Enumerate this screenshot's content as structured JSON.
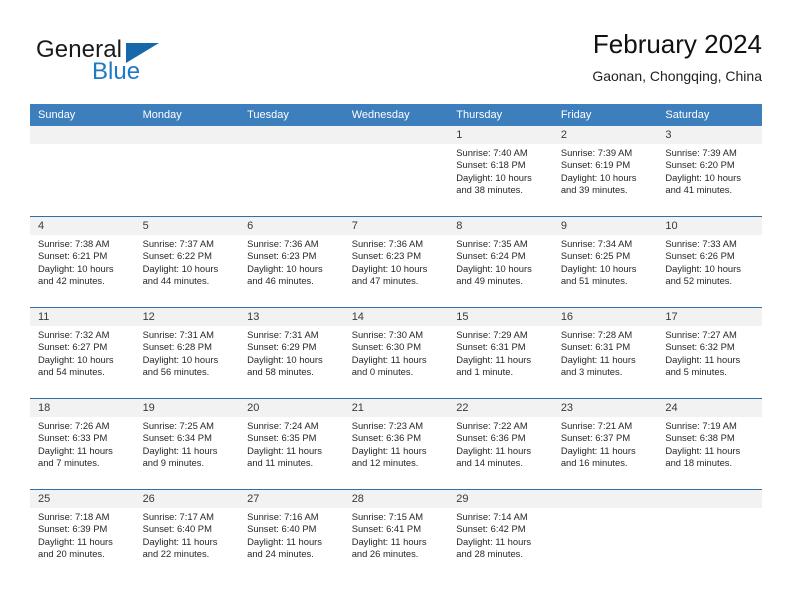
{
  "logo": {
    "word_top": "General",
    "word_bottom": "Blue",
    "triangle_color": "#1767ab",
    "blue_color": "#1f7ac4"
  },
  "header": {
    "title": "February 2024",
    "subtitle": "Gaonan, Chongqing, China"
  },
  "theme": {
    "header_bg": "#3d7ebd",
    "daynum_bg": "#f2f2f2",
    "row_divider": "#2f6fae"
  },
  "weekdays": [
    "Sunday",
    "Monday",
    "Tuesday",
    "Wednesday",
    "Thursday",
    "Friday",
    "Saturday"
  ],
  "weeks": [
    [
      {
        "day": "",
        "sunrise": "",
        "sunset": "",
        "daylight_line1": "",
        "daylight_line2": ""
      },
      {
        "day": "",
        "sunrise": "",
        "sunset": "",
        "daylight_line1": "",
        "daylight_line2": ""
      },
      {
        "day": "",
        "sunrise": "",
        "sunset": "",
        "daylight_line1": "",
        "daylight_line2": ""
      },
      {
        "day": "",
        "sunrise": "",
        "sunset": "",
        "daylight_line1": "",
        "daylight_line2": ""
      },
      {
        "day": "1",
        "sunrise": "Sunrise: 7:40 AM",
        "sunset": "Sunset: 6:18 PM",
        "daylight_line1": "Daylight: 10 hours",
        "daylight_line2": "and 38 minutes."
      },
      {
        "day": "2",
        "sunrise": "Sunrise: 7:39 AM",
        "sunset": "Sunset: 6:19 PM",
        "daylight_line1": "Daylight: 10 hours",
        "daylight_line2": "and 39 minutes."
      },
      {
        "day": "3",
        "sunrise": "Sunrise: 7:39 AM",
        "sunset": "Sunset: 6:20 PM",
        "daylight_line1": "Daylight: 10 hours",
        "daylight_line2": "and 41 minutes."
      }
    ],
    [
      {
        "day": "4",
        "sunrise": "Sunrise: 7:38 AM",
        "sunset": "Sunset: 6:21 PM",
        "daylight_line1": "Daylight: 10 hours",
        "daylight_line2": "and 42 minutes."
      },
      {
        "day": "5",
        "sunrise": "Sunrise: 7:37 AM",
        "sunset": "Sunset: 6:22 PM",
        "daylight_line1": "Daylight: 10 hours",
        "daylight_line2": "and 44 minutes."
      },
      {
        "day": "6",
        "sunrise": "Sunrise: 7:36 AM",
        "sunset": "Sunset: 6:23 PM",
        "daylight_line1": "Daylight: 10 hours",
        "daylight_line2": "and 46 minutes."
      },
      {
        "day": "7",
        "sunrise": "Sunrise: 7:36 AM",
        "sunset": "Sunset: 6:23 PM",
        "daylight_line1": "Daylight: 10 hours",
        "daylight_line2": "and 47 minutes."
      },
      {
        "day": "8",
        "sunrise": "Sunrise: 7:35 AM",
        "sunset": "Sunset: 6:24 PM",
        "daylight_line1": "Daylight: 10 hours",
        "daylight_line2": "and 49 minutes."
      },
      {
        "day": "9",
        "sunrise": "Sunrise: 7:34 AM",
        "sunset": "Sunset: 6:25 PM",
        "daylight_line1": "Daylight: 10 hours",
        "daylight_line2": "and 51 minutes."
      },
      {
        "day": "10",
        "sunrise": "Sunrise: 7:33 AM",
        "sunset": "Sunset: 6:26 PM",
        "daylight_line1": "Daylight: 10 hours",
        "daylight_line2": "and 52 minutes."
      }
    ],
    [
      {
        "day": "11",
        "sunrise": "Sunrise: 7:32 AM",
        "sunset": "Sunset: 6:27 PM",
        "daylight_line1": "Daylight: 10 hours",
        "daylight_line2": "and 54 minutes."
      },
      {
        "day": "12",
        "sunrise": "Sunrise: 7:31 AM",
        "sunset": "Sunset: 6:28 PM",
        "daylight_line1": "Daylight: 10 hours",
        "daylight_line2": "and 56 minutes."
      },
      {
        "day": "13",
        "sunrise": "Sunrise: 7:31 AM",
        "sunset": "Sunset: 6:29 PM",
        "daylight_line1": "Daylight: 10 hours",
        "daylight_line2": "and 58 minutes."
      },
      {
        "day": "14",
        "sunrise": "Sunrise: 7:30 AM",
        "sunset": "Sunset: 6:30 PM",
        "daylight_line1": "Daylight: 11 hours",
        "daylight_line2": "and 0 minutes."
      },
      {
        "day": "15",
        "sunrise": "Sunrise: 7:29 AM",
        "sunset": "Sunset: 6:31 PM",
        "daylight_line1": "Daylight: 11 hours",
        "daylight_line2": "and 1 minute."
      },
      {
        "day": "16",
        "sunrise": "Sunrise: 7:28 AM",
        "sunset": "Sunset: 6:31 PM",
        "daylight_line1": "Daylight: 11 hours",
        "daylight_line2": "and 3 minutes."
      },
      {
        "day": "17",
        "sunrise": "Sunrise: 7:27 AM",
        "sunset": "Sunset: 6:32 PM",
        "daylight_line1": "Daylight: 11 hours",
        "daylight_line2": "and 5 minutes."
      }
    ],
    [
      {
        "day": "18",
        "sunrise": "Sunrise: 7:26 AM",
        "sunset": "Sunset: 6:33 PM",
        "daylight_line1": "Daylight: 11 hours",
        "daylight_line2": "and 7 minutes."
      },
      {
        "day": "19",
        "sunrise": "Sunrise: 7:25 AM",
        "sunset": "Sunset: 6:34 PM",
        "daylight_line1": "Daylight: 11 hours",
        "daylight_line2": "and 9 minutes."
      },
      {
        "day": "20",
        "sunrise": "Sunrise: 7:24 AM",
        "sunset": "Sunset: 6:35 PM",
        "daylight_line1": "Daylight: 11 hours",
        "daylight_line2": "and 11 minutes."
      },
      {
        "day": "21",
        "sunrise": "Sunrise: 7:23 AM",
        "sunset": "Sunset: 6:36 PM",
        "daylight_line1": "Daylight: 11 hours",
        "daylight_line2": "and 12 minutes."
      },
      {
        "day": "22",
        "sunrise": "Sunrise: 7:22 AM",
        "sunset": "Sunset: 6:36 PM",
        "daylight_line1": "Daylight: 11 hours",
        "daylight_line2": "and 14 minutes."
      },
      {
        "day": "23",
        "sunrise": "Sunrise: 7:21 AM",
        "sunset": "Sunset: 6:37 PM",
        "daylight_line1": "Daylight: 11 hours",
        "daylight_line2": "and 16 minutes."
      },
      {
        "day": "24",
        "sunrise": "Sunrise: 7:19 AM",
        "sunset": "Sunset: 6:38 PM",
        "daylight_line1": "Daylight: 11 hours",
        "daylight_line2": "and 18 minutes."
      }
    ],
    [
      {
        "day": "25",
        "sunrise": "Sunrise: 7:18 AM",
        "sunset": "Sunset: 6:39 PM",
        "daylight_line1": "Daylight: 11 hours",
        "daylight_line2": "and 20 minutes."
      },
      {
        "day": "26",
        "sunrise": "Sunrise: 7:17 AM",
        "sunset": "Sunset: 6:40 PM",
        "daylight_line1": "Daylight: 11 hours",
        "daylight_line2": "and 22 minutes."
      },
      {
        "day": "27",
        "sunrise": "Sunrise: 7:16 AM",
        "sunset": "Sunset: 6:40 PM",
        "daylight_line1": "Daylight: 11 hours",
        "daylight_line2": "and 24 minutes."
      },
      {
        "day": "28",
        "sunrise": "Sunrise: 7:15 AM",
        "sunset": "Sunset: 6:41 PM",
        "daylight_line1": "Daylight: 11 hours",
        "daylight_line2": "and 26 minutes."
      },
      {
        "day": "29",
        "sunrise": "Sunrise: 7:14 AM",
        "sunset": "Sunset: 6:42 PM",
        "daylight_line1": "Daylight: 11 hours",
        "daylight_line2": "and 28 minutes."
      },
      {
        "day": "",
        "sunrise": "",
        "sunset": "",
        "daylight_line1": "",
        "daylight_line2": ""
      },
      {
        "day": "",
        "sunrise": "",
        "sunset": "",
        "daylight_line1": "",
        "daylight_line2": ""
      }
    ]
  ]
}
